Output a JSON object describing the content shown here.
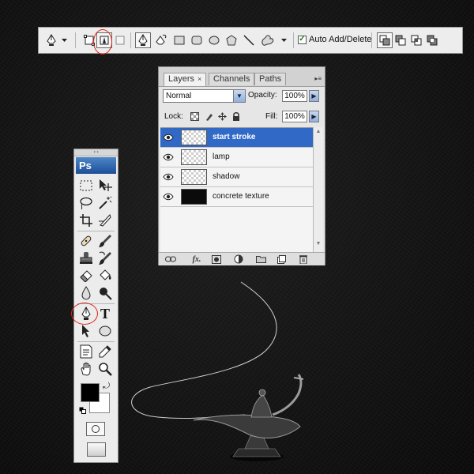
{
  "options_bar": {
    "auto_add_delete_label": "Auto Add/Delete",
    "auto_add_delete_checked": true,
    "icons": [
      "pen-preset-icon",
      "dropdown-arrow-icon",
      "shape-layers-icon",
      "paths-icon",
      "fill-pixels-icon",
      "pen-tool-icon",
      "freeform-pen-icon",
      "rectangle-icon",
      "rounded-rectangle-icon",
      "ellipse-icon",
      "polygon-icon",
      "line-icon",
      "custom-shape-icon",
      "dropdown-arrow-icon",
      "add-to-path-icon",
      "subtract-path-icon",
      "intersect-path-icon",
      "exclude-path-icon"
    ]
  },
  "layers_panel": {
    "tabs": [
      {
        "label": "Layers",
        "close": "×",
        "active": true
      },
      {
        "label": "Channels",
        "active": false
      },
      {
        "label": "Paths",
        "active": false
      }
    ],
    "blend_mode": "Normal",
    "opacity_label": "Opacity:",
    "opacity_value": "100%",
    "lock_label": "Lock:",
    "fill_label": "Fill:",
    "fill_value": "100%",
    "layers": [
      {
        "name": "start stroke",
        "selected": true,
        "visible": true,
        "thumbnail": "transparent"
      },
      {
        "name": "lamp",
        "selected": false,
        "visible": true,
        "thumbnail": "transparent"
      },
      {
        "name": "shadow",
        "selected": false,
        "visible": true,
        "thumbnail": "transparent"
      },
      {
        "name": "concrete texture",
        "selected": false,
        "visible": true,
        "thumbnail": "dark"
      }
    ],
    "footer_fx": "fx."
  },
  "tools_panel": {
    "logo": "Ps",
    "text_tool_glyph": "T",
    "foreground_color": "#000000",
    "background_color": "#ffffff"
  },
  "colors": {
    "selection_blue": "#3169c6",
    "annotation_red": "#e0241c",
    "canvas_dark": "#141414"
  }
}
